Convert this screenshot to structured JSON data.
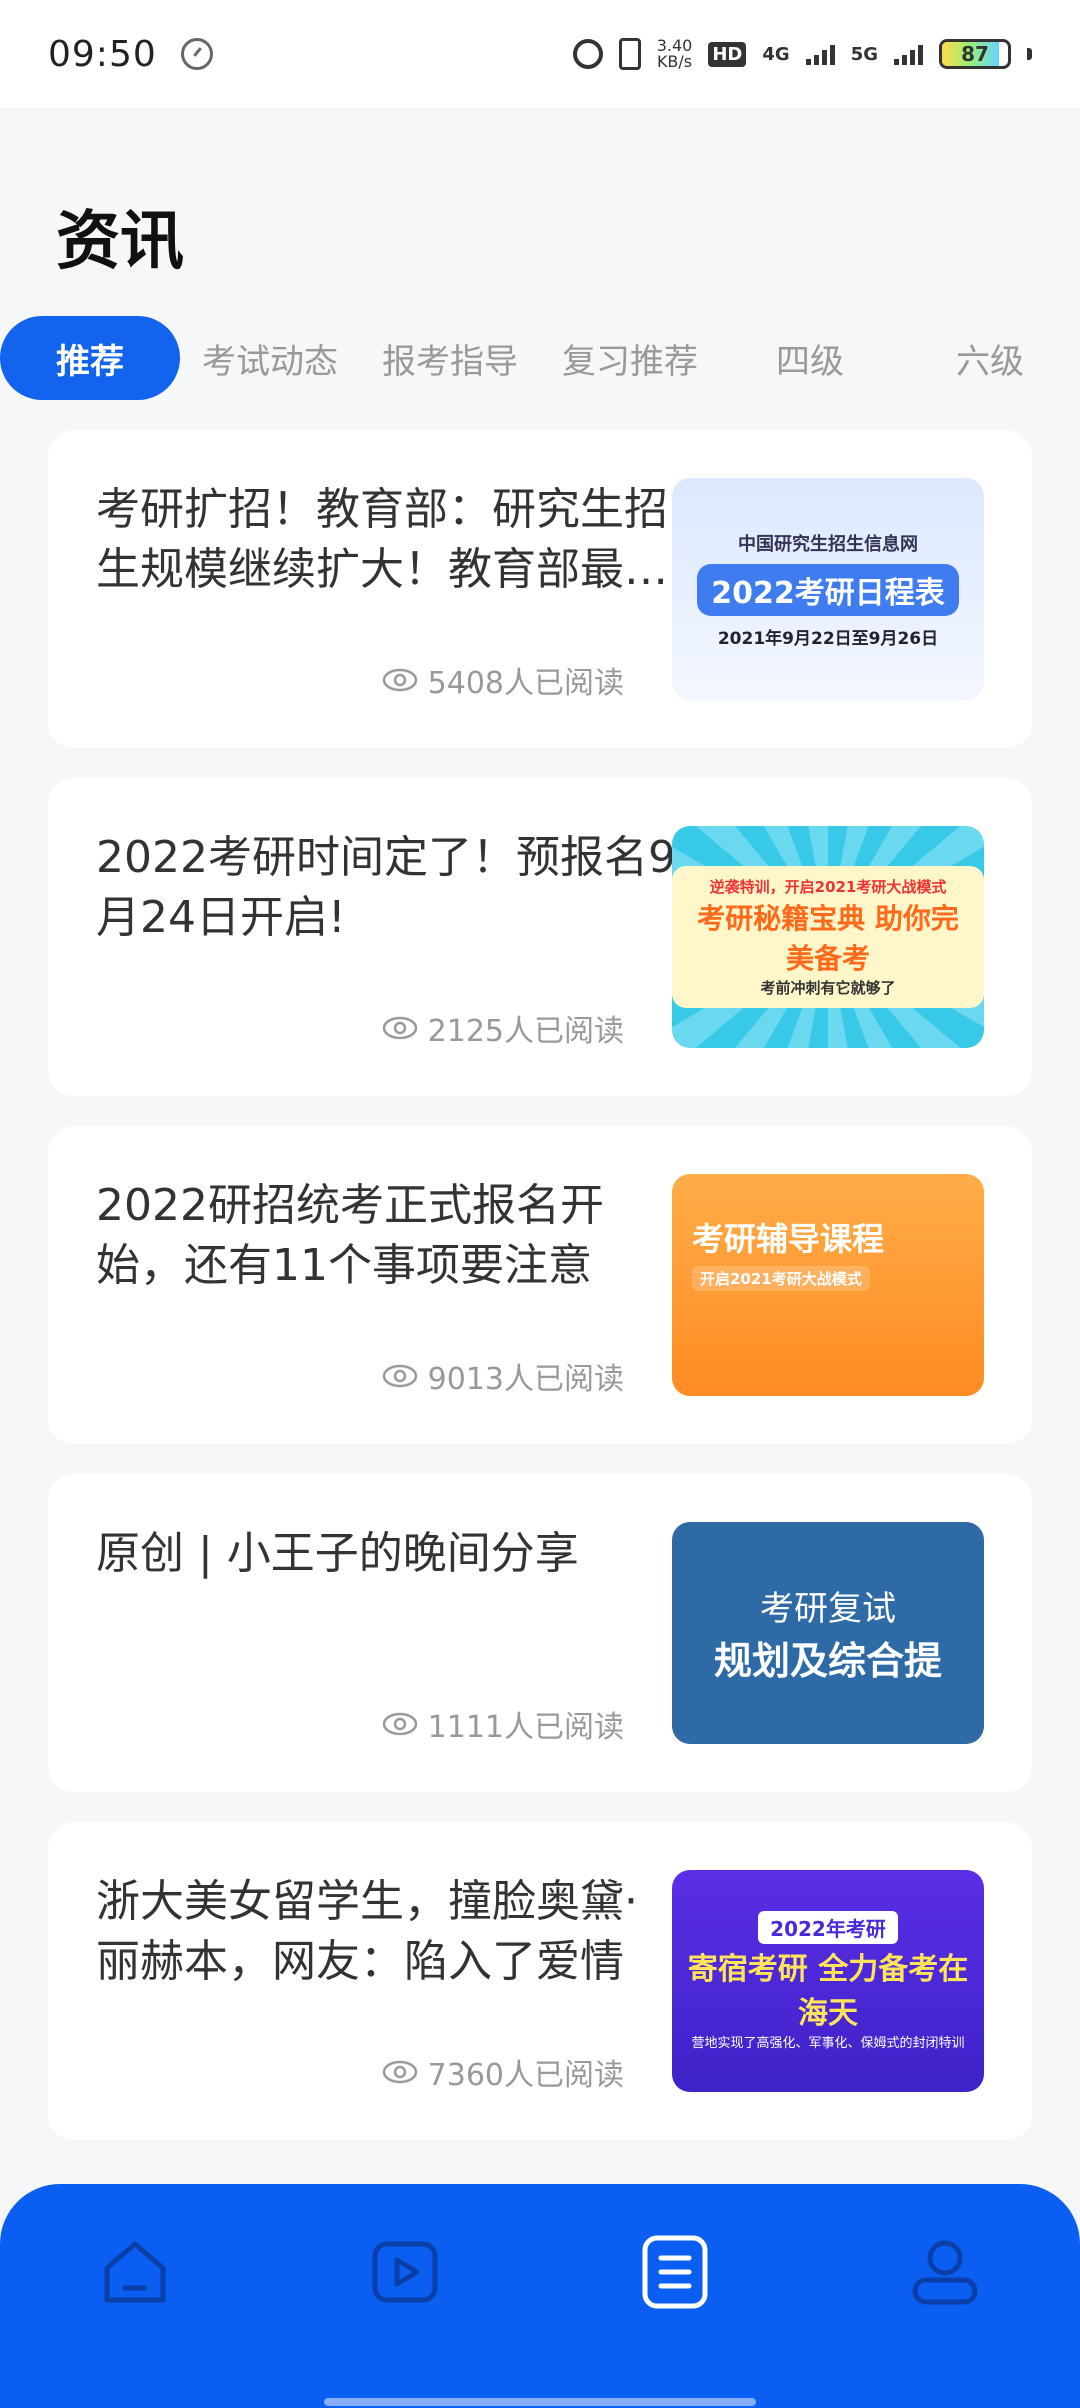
{
  "status_bar": {
    "time": "09:50",
    "speed_value": "3.40",
    "speed_unit": "KB/s",
    "hd": "HD",
    "net1": "4G",
    "net2": "5G",
    "battery": "87",
    "battery_level": 0.87
  },
  "header": {
    "title": "资讯"
  },
  "tabs": [
    {
      "label": "推荐",
      "active": true
    },
    {
      "label": "考试动态",
      "active": false
    },
    {
      "label": "报考指导",
      "active": false
    },
    {
      "label": "复习推荐",
      "active": false
    },
    {
      "label": "四级",
      "active": false
    },
    {
      "label": "六级",
      "active": false
    }
  ],
  "articles": [
    {
      "title": "考研扩招！教育部：研究生招生规模继续扩大！教育部最新通知",
      "views": "5408人已阅读",
      "thumb": {
        "line1": "中国研究生招生信息网",
        "line2": "2022考研日程表",
        "line3": "2021年9月22日至9月26日"
      }
    },
    {
      "title": "2022考研时间定了！预报名9月24日开启!",
      "views": "2125人已阅读",
      "thumb": {
        "line1": "逆袭特训，开启2021考研大战模式",
        "line2": "考研秘籍宝典 助你完美备考",
        "line3": "考前冲刺有它就够了"
      }
    },
    {
      "title": "2022研招统考正式报名开始，还有11个事项要注意",
      "views": "9013人已阅读",
      "thumb": {
        "line1": "开启2021考研大战模式",
        "line2": "考研辅导课程",
        "line3": ""
      }
    },
    {
      "title": "原创 | 小王子的晚间分享",
      "views": "1111人已阅读",
      "thumb": {
        "line1": "考研复试",
        "line2": "规划及综合提",
        "line3": ""
      }
    },
    {
      "title": "浙大美女留学生，撞脸奥黛·丽赫本，网友：陷入了爱情",
      "views": "7360人已阅读",
      "thumb": {
        "line1": "2022年考研",
        "line2": "寄宿考研 全力备考在海天",
        "line3": "营地实现了高强化、军事化、保姆式的封闭特训"
      }
    }
  ],
  "bottom_nav": [
    {
      "icon": "home-icon",
      "active": false
    },
    {
      "icon": "video-icon",
      "active": false
    },
    {
      "icon": "news-icon",
      "active": true
    },
    {
      "icon": "profile-icon",
      "active": false
    }
  ],
  "colors": {
    "accent": "#1263ee",
    "nav_bg": "#0b5ef2",
    "page_bg": "#f6f7f9"
  }
}
